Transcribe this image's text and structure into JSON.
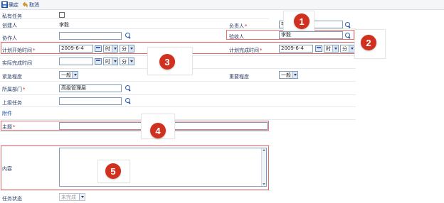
{
  "toolbar": {
    "confirm_label": "确定",
    "cancel_label": "取消"
  },
  "form": {
    "private_task": {
      "label": "私有任务",
      "checked": false
    },
    "creator": {
      "label": "创建人",
      "value": "李毅"
    },
    "owner": {
      "label": "负责人",
      "required": "*",
      "value": "李毅"
    },
    "collaborator": {
      "label": "协作人",
      "value": ""
    },
    "acceptor": {
      "label": "验收人",
      "value": "李毅"
    },
    "planned_start": {
      "label": "计划开始时间",
      "required": "*",
      "date": "2009-6-4",
      "hour": "时",
      "minute": "分"
    },
    "planned_end": {
      "label": "计划完成时间",
      "required": "*",
      "date": "2009-6-4",
      "hour": "时",
      "minute": "分"
    },
    "actual_end": {
      "label": "实际完成时间",
      "date": "",
      "hour": "时",
      "minute": "分"
    },
    "urgency": {
      "label": "紧急程度",
      "value": "一般"
    },
    "importance": {
      "label": "重要程度",
      "value": "一般"
    },
    "department": {
      "label": "所属部门",
      "required": "*",
      "value": "高级管理层"
    },
    "parent_task": {
      "label": "上级任务",
      "value": ""
    },
    "attachment": {
      "label": "附件"
    },
    "subject": {
      "label": "主题",
      "required": "*",
      "value": ""
    },
    "content": {
      "label": "内容",
      "value": ""
    },
    "status": {
      "label": "任务状态",
      "value": "未完成"
    }
  },
  "callouts": [
    "1",
    "2",
    "3",
    "4",
    "5"
  ],
  "colors": {
    "badge": "#d0311f",
    "highlight": "#e36a6a",
    "label_text": "#2a3f66",
    "required": "#d01b1b"
  }
}
